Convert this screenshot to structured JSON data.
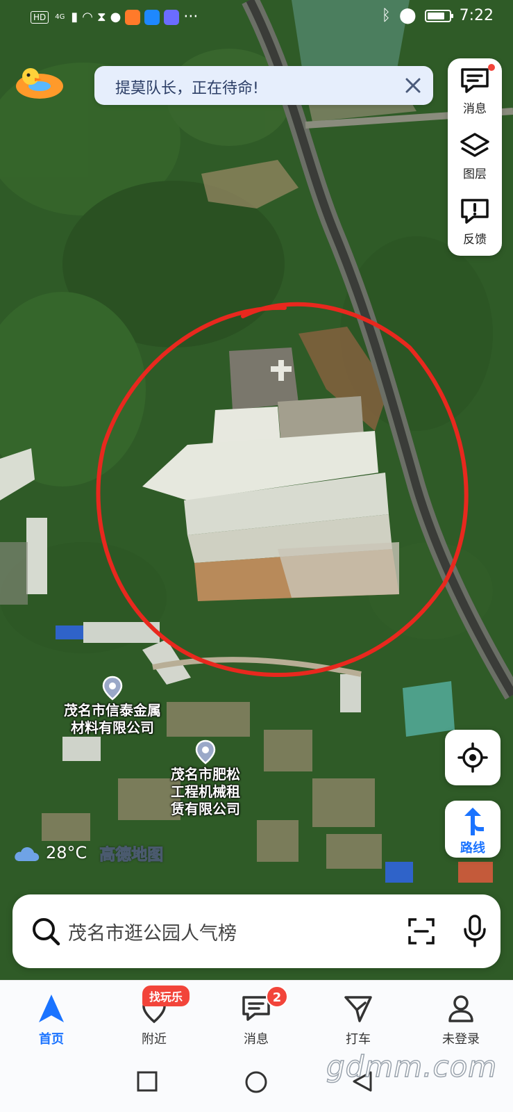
{
  "status_bar": {
    "network_chip": "HD",
    "network_type": "4G",
    "time": "7:22",
    "more": "···"
  },
  "banner": {
    "text": "提莫队长，正在待命!"
  },
  "tools": {
    "message_label": "消息",
    "layers_label": "图层",
    "feedback_label": "反馈"
  },
  "map": {
    "pois": [
      {
        "line1": "茂名市信泰金属",
        "line2": "材料有限公司"
      },
      {
        "line1": "茂名市肥松",
        "line2": "工程机械租",
        "line3": "赁有限公司"
      }
    ],
    "weather": "28°C",
    "brand": "高德地图"
  },
  "route_button": {
    "label": "路线"
  },
  "search": {
    "placeholder": "茂名市逛公园人气榜"
  },
  "bottom_nav": {
    "items": [
      {
        "label": "首页"
      },
      {
        "label": "附近"
      },
      {
        "label": "消息"
      },
      {
        "label": "打车"
      },
      {
        "label": "未登录"
      }
    ],
    "nearby_tag": "找玩乐",
    "message_badge": "2"
  },
  "watermark": "gdmm.com",
  "colors": {
    "accent": "#1a73ff",
    "alert": "#f2443a",
    "annotation": "#e8281e"
  }
}
